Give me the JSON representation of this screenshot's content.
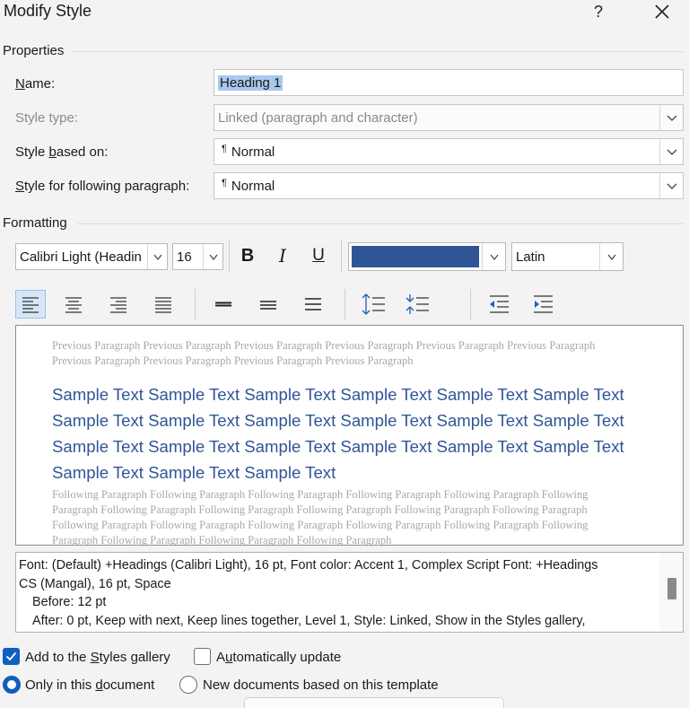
{
  "window": {
    "title": "Modify Style",
    "help_label": "?"
  },
  "properties": {
    "section_label": "Properties",
    "name": {
      "label_pre": "",
      "label_u": "N",
      "label_post": "ame:",
      "value": "Heading 1"
    },
    "style_type": {
      "label": "Style type:",
      "value": "Linked (paragraph and character)"
    },
    "based_on": {
      "label_pre": "Style ",
      "label_u": "b",
      "label_post": "ased on:",
      "pilcrow": "¶",
      "value": "Normal"
    },
    "following": {
      "label_pre": "",
      "label_u": "S",
      "label_post": "tyle for following paragraph:",
      "pilcrow": "¶",
      "value": "Normal"
    }
  },
  "formatting": {
    "section_label": "Formatting",
    "font_name": "Calibri Light (Headin",
    "font_size": "16",
    "bold_label": "B",
    "italic_label": "I",
    "underline_label": "U",
    "font_color": "#2f5597",
    "script": "Latin"
  },
  "preview": {
    "previous_text": "Previous Paragraph Previous Paragraph Previous Paragraph Previous Paragraph Previous Paragraph Previous Paragraph Previous Paragraph Previous Paragraph Previous Paragraph Previous Paragraph",
    "sample_text": "Sample Text Sample Text Sample Text Sample Text Sample Text Sample Text Sample Text Sample Text Sample Text Sample Text Sample Text Sample Text Sample Text Sample Text Sample Text Sample Text Sample Text Sample Text Sample Text Sample Text Sample Text",
    "following_text": "Following Paragraph Following Paragraph Following Paragraph Following Paragraph Following Paragraph Following Paragraph Following Paragraph Following Paragraph Following Paragraph Following Paragraph Following Paragraph Following Paragraph Following Paragraph Following Paragraph Following Paragraph Following Paragraph Following Paragraph Following Paragraph Following Paragraph Following Paragraph"
  },
  "description": {
    "line1": "Font: (Default) +Headings (Calibri Light), 16 pt, Font color: Accent 1, Complex Script Font: +Headings",
    "line2": "CS (Mangal), 16 pt, Space",
    "line3": "Before:  12 pt",
    "line4": "After:  0 pt, Keep with next, Keep lines together, Level 1, Style: Linked, Show in the Styles gallery,"
  },
  "options": {
    "add_to_gallery": {
      "pre": "Add to the ",
      "u": "S",
      "post": "tyles gallery",
      "checked": true
    },
    "auto_update": {
      "pre": "A",
      "u": "u",
      "post": "tomatically update",
      "checked": false
    },
    "only_this_doc": {
      "pre": "Only in this ",
      "u": "d",
      "post": "ocument",
      "selected": true
    },
    "new_docs": {
      "label": "New documents based on this template",
      "selected": false
    }
  },
  "colors": {
    "accent": "#0f5fbf",
    "heading_blue": "#2f5597"
  }
}
